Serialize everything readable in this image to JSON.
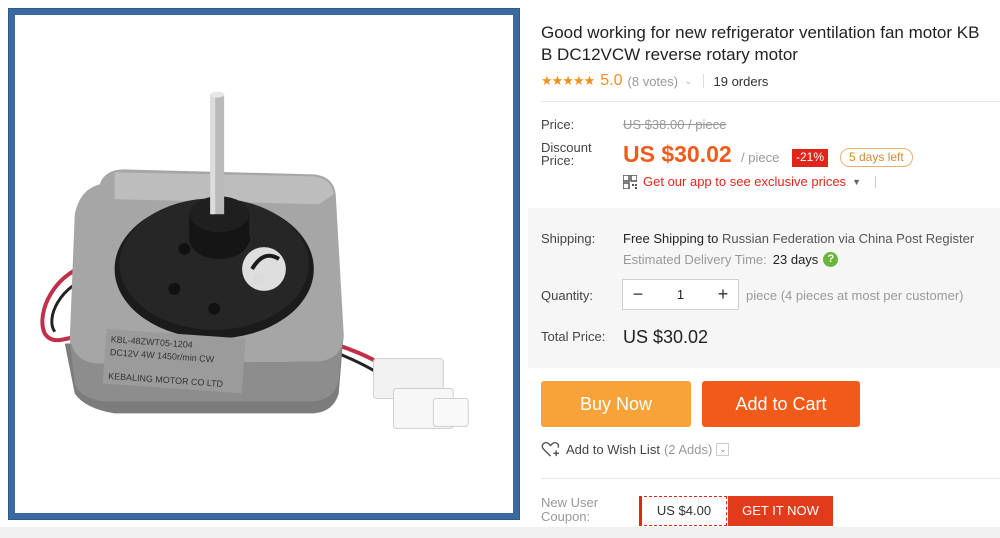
{
  "product": {
    "title_line1": "Good working for new refrigerator ventilation fan motor KB",
    "title_line2": "B DC12VCW reverse rotary motor",
    "image_label_lines": [
      "KBL-48ZWT05-1204",
      "DC12V 4W 1450r/min CW",
      "KEBALING MOTOR CO LTD"
    ]
  },
  "rating": {
    "stars": "★★★★★",
    "value": "5.0",
    "votes": "(8 votes)",
    "orders": "19 orders"
  },
  "price": {
    "label": "Price:",
    "old": "US $38.00 / piece",
    "discount_label": "Discount Price:",
    "discount_label_line1": "Discount",
    "discount_label_line2": "Price:",
    "discount": "US $30.02",
    "per_piece": "/ piece",
    "off": "-21%",
    "days_left": "5 days left",
    "app_link": "Get our app to see exclusive prices"
  },
  "shipping": {
    "label": "Shipping:",
    "main_prefix": "Free Shipping to ",
    "destination": "Russian Federation via China Post Register",
    "est_label": "Estimated Delivery Time:",
    "est_days": "23 days",
    "help_icon": "?"
  },
  "quantity": {
    "label": "Quantity:",
    "minus": "−",
    "value": "1",
    "plus": "+",
    "note": "piece (4 pieces at most per customer)"
  },
  "total": {
    "label": "Total Price:",
    "value": "US $30.02"
  },
  "buttons": {
    "buy_now": "Buy Now",
    "add_to_cart": "Add to Cart"
  },
  "wishlist": {
    "label": "Add to Wish List",
    "count": "(2 Adds)",
    "dropdown": "⌄"
  },
  "coupon": {
    "label_line1": "New User",
    "label_line2": "Coupon:",
    "value": "US $4.00",
    "button": "GET IT NOW"
  },
  "colors": {
    "accent_orange": "#f25a1a",
    "buy_orange": "#f7a33a",
    "star_orange": "#f28f1a",
    "badge_red": "#e0261b",
    "image_frame_blue": "#3b6aa1"
  }
}
